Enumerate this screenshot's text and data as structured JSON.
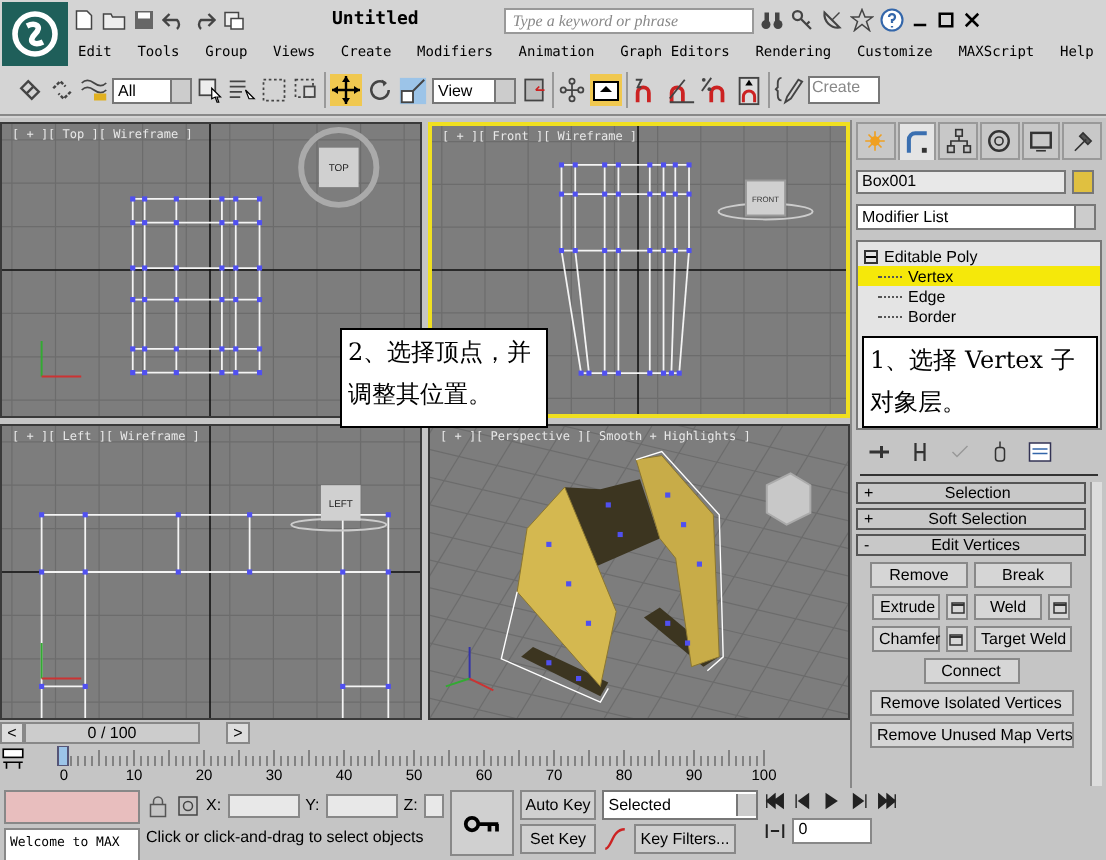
{
  "window": {
    "title": "Untitled"
  },
  "search": {
    "placeholder": "Type a keyword or phrase"
  },
  "menu": [
    "Edit",
    "Tools",
    "Group",
    "Views",
    "Create",
    "Modifiers",
    "Animation",
    "Graph Editors",
    "Rendering",
    "Customize",
    "MAXScript",
    "Help"
  ],
  "toolbar": {
    "selection_filter": "All",
    "reference_coordinate": "View",
    "named_selection": "Create"
  },
  "viewports": [
    {
      "kind": "top",
      "label": "[ + ][ Top ][ Wireframe ]",
      "active": false,
      "cube_label": "TOP"
    },
    {
      "kind": "front",
      "label": "[ + ][ Front ][ Wireframe ]",
      "active": true,
      "cube_label": "FRONT"
    },
    {
      "kind": "left",
      "label": "[ + ][ Left ][ Wireframe ]",
      "active": false,
      "cube_label": "LEFT"
    },
    {
      "kind": "perspective",
      "label": "[ + ][ Perspective ][ Smooth + Highlights ]",
      "active": false
    }
  ],
  "callouts": [
    {
      "text": "2、选择顶点，并调整其位置。"
    },
    {
      "text": "1、选择 Vertex 子对象层。"
    }
  ],
  "command_panel": {
    "tabs": [
      {
        "kind": "create",
        "selected": false
      },
      {
        "kind": "modify",
        "selected": true
      },
      {
        "kind": "hierarchy",
        "selected": false
      },
      {
        "kind": "motion",
        "selected": false
      },
      {
        "kind": "display",
        "selected": false
      },
      {
        "kind": "utilities",
        "selected": false
      }
    ],
    "object_name": "Box001",
    "modifier_list": "Modifier List",
    "stack": [
      {
        "label": "Editable Poly",
        "expanded": true,
        "children": [
          {
            "label": "Vertex",
            "selected": true
          },
          {
            "label": "Edge",
            "selected": false
          },
          {
            "label": "Border",
            "selected": false
          }
        ]
      }
    ],
    "rollouts": [
      {
        "toggle": "+",
        "title": "Selection"
      },
      {
        "toggle": "+",
        "title": "Soft Selection"
      },
      {
        "toggle": "-",
        "title": "Edit Vertices"
      }
    ],
    "button_rows": [
      [
        {
          "label": "Remove",
          "settings": false
        },
        {
          "label": "Break",
          "settings": false
        }
      ],
      [
        {
          "label": "Extrude",
          "settings": true
        },
        {
          "label": "Weld",
          "settings": true
        }
      ],
      [
        {
          "label": "Chamfer",
          "settings": true
        },
        {
          "label": "Target Weld",
          "settings": false
        }
      ],
      [
        {
          "label": "Connect",
          "settings": false
        }
      ],
      [
        {
          "label": "Remove Isolated Vertices",
          "settings": false
        }
      ],
      [
        {
          "label": "Remove Unused Map Verts",
          "settings": false
        }
      ]
    ]
  },
  "time_slider": {
    "prev": "<",
    "reading": "0 / 100",
    "next": ">",
    "level": 0
  },
  "track_ticks": [
    "0",
    "10",
    "20",
    "30",
    "40",
    "50",
    "60",
    "70",
    "80",
    "90",
    "100"
  ],
  "status": {
    "script_listener": "Welcome to MAX",
    "prompt": "Click or click-and-drag to select objects",
    "coords": [
      {
        "axis": "X:"
      },
      {
        "axis": "Y:"
      },
      {
        "axis": "Z:"
      }
    ],
    "auto_key": "Auto Key",
    "set_key": "Set Key",
    "key_mode": "Selected",
    "key_filters": "Key Filters...",
    "frame": "0"
  }
}
